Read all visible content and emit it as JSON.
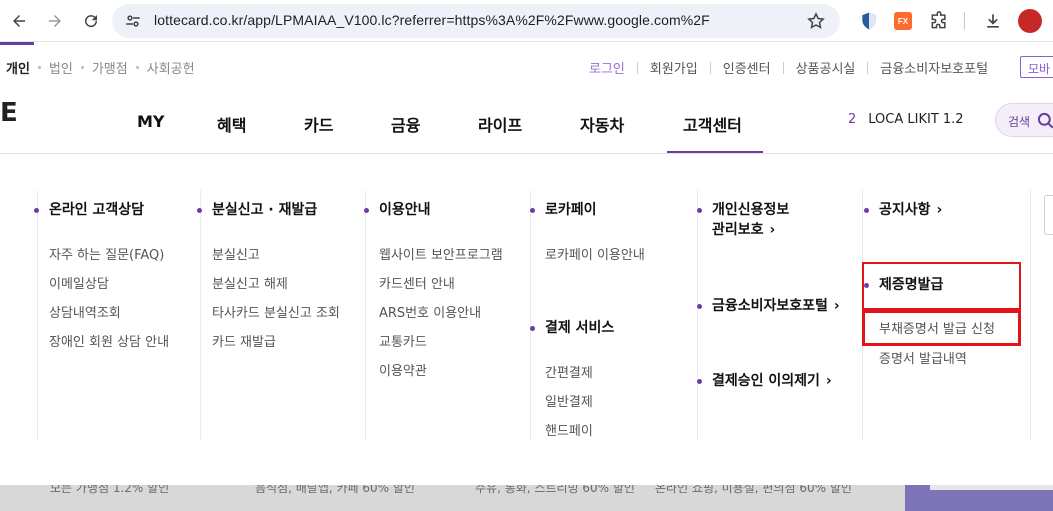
{
  "browser": {
    "url": "lottecard.co.kr/app/LPMAIAA_V100.lc?referrer=https%3A%2F%2Fwww.google.com%2F",
    "ext_fx_label": "FX"
  },
  "top": {
    "segments": [
      "개인",
      "법인",
      "가맹점",
      "사회공헌"
    ],
    "util_links": [
      "로그인",
      "회원가입",
      "인증센터",
      "상품공시실",
      "금융소비자보호포털"
    ],
    "mobile_label": "모바",
    "logo_fragment": "E"
  },
  "gnb": {
    "items": [
      "MY",
      "혜택",
      "카드",
      "금융",
      "라이프",
      "자동차",
      "고객센터"
    ],
    "active": "고객센터",
    "loca_num": "2",
    "loca_text": "LOCA LIKIT 1.2",
    "search_label": "검색"
  },
  "menu": {
    "col1": {
      "title": "온라인 고객상담",
      "items": [
        "자주 하는 질문(FAQ)",
        "이메일상담",
        "상담내역조회",
        "장애인 회원 상담 안내"
      ]
    },
    "col2": {
      "title": "분실신고 · 재발급",
      "items": [
        "분실신고",
        "분실신고 해제",
        "타사카드 분실신고 조회",
        "카드 재발급"
      ]
    },
    "col3": {
      "title": "이용안내",
      "items": [
        "웹사이트 보안프로그램",
        "카드센터 안내",
        "ARS번호 이용안내",
        "교통카드",
        "이용약관"
      ]
    },
    "col4": {
      "title": "로카페이",
      "items": [
        "로카페이 이용안내"
      ],
      "title2": "결제 서비스",
      "items2": [
        "간편결제",
        "일반결제",
        "핸드페이"
      ]
    },
    "col5": {
      "title_line1": "개인신용정보",
      "title_line2": "관리보호",
      "title2": "금융소비자보호포털",
      "title3": "결제승인 이의제기"
    },
    "col6": {
      "title": "공지사항",
      "title2": "제증명발급",
      "items": [
        "부채증명서 발급 신청",
        "증명서 발급내역"
      ]
    },
    "chevron": "›"
  },
  "background": {
    "texts": [
      "모든 가맹점 1.2% 할인",
      "음식점, 배달앱, 카페 60% 할인",
      "주유, 통화, 스트리밍 60% 할인",
      "온라인 쇼핑, 미용실, 편의점 60% 할인"
    ]
  }
}
